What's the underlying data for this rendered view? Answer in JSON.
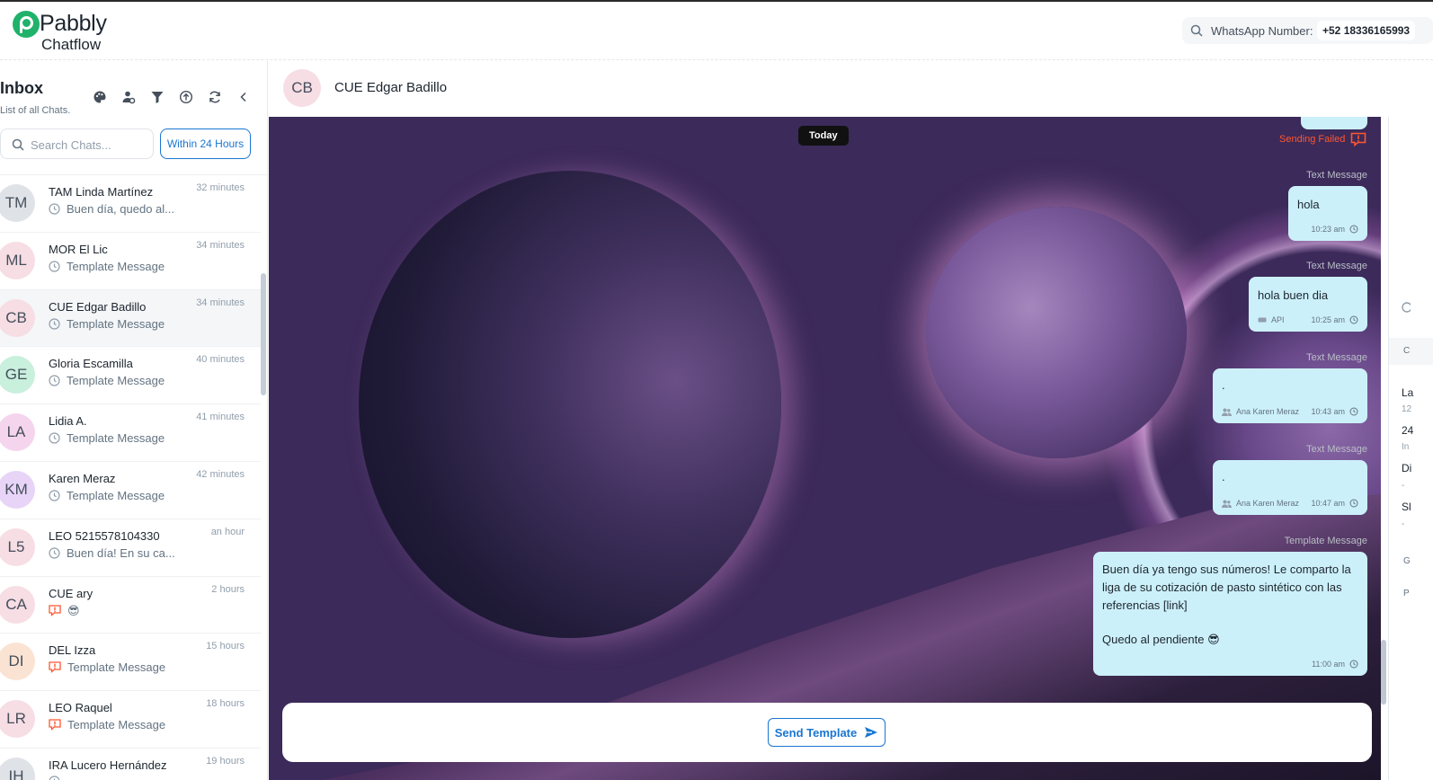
{
  "brand": {
    "name": "Pabbly",
    "sub": "Chatflow"
  },
  "header": {
    "wa_label": "WhatsApp Number:",
    "wa_number": "+52 18336165993"
  },
  "sidebar": {
    "title": "Inbox",
    "subtitle": "List of all Chats.",
    "search_placeholder": "Search Chats...",
    "filter_button": "Within 24 Hours",
    "tool_icons": [
      "palette-icon",
      "user-assign-icon",
      "filter-icon",
      "upload-icon",
      "refresh-icon",
      "chevron-left-icon"
    ],
    "chats": [
      {
        "initials": "TM",
        "name": "TAM Linda Martínez",
        "time": "32 minutes",
        "preview": "Buen día, quedo al...",
        "status": "clock",
        "avatar_color": "#dfe3e8"
      },
      {
        "initials": "ML",
        "name": "MOR El Lic",
        "time": "34 minutes",
        "preview": "Template Message",
        "status": "clock",
        "avatar_color": "#f7dde4"
      },
      {
        "initials": "CB",
        "name": "CUE Edgar Badillo",
        "time": "34 minutes",
        "preview": "Template Message",
        "status": "clock",
        "avatar_color": "#f7dde4"
      },
      {
        "initials": "GE",
        "name": "Gloria Escamilla",
        "time": "40 minutes",
        "preview": "Template Message",
        "status": "clock",
        "avatar_color": "#c9efdd"
      },
      {
        "initials": "LA",
        "name": "Lidia A.",
        "time": "41 minutes",
        "preview": "Template Message",
        "status": "clock",
        "avatar_color": "#f5d5ee"
      },
      {
        "initials": "KM",
        "name": "Karen Meraz",
        "time": "42 minutes",
        "preview": "Template Message",
        "status": "clock",
        "avatar_color": "#e8d4f7"
      },
      {
        "initials": "L5",
        "name": "LEO 5215578104330",
        "time": "an hour",
        "preview": "Buen día! En su ca...",
        "status": "clock",
        "avatar_color": "#f7dde4"
      },
      {
        "initials": "CA",
        "name": "CUE ary",
        "time": "2 hours",
        "preview": "😎",
        "status": "failed",
        "avatar_color": "#f7dde4"
      },
      {
        "initials": "DI",
        "name": "DEL Izza",
        "time": "15 hours",
        "preview": "Template Message",
        "status": "failed",
        "avatar_color": "#fbe3d3"
      },
      {
        "initials": "LR",
        "name": "LEO Raquel",
        "time": "18 hours",
        "preview": "Template Message",
        "status": "failed",
        "avatar_color": "#f7dde4"
      },
      {
        "initials": "IH",
        "name": "IRA Lucero Hernández",
        "time": "19 hours",
        "preview": "",
        "status": "clock",
        "avatar_color": "#dfe3e8"
      }
    ]
  },
  "chat": {
    "contact_initials": "CB",
    "contact_name": "CUE Edgar Badillo",
    "date_label": "Today",
    "sending_failed": "Sending Failed",
    "messages": [
      {
        "type": "Text Message",
        "text": "hola",
        "time": "10:23 am",
        "sender": ""
      },
      {
        "type": "Text Message",
        "text": "hola buen dia",
        "time": "10:25 am",
        "sender": "API"
      },
      {
        "type": "Text Message",
        "text": ".",
        "time": "10:43 am",
        "sender": "Ana Karen Meraz"
      },
      {
        "type": "Text Message",
        "text": ".",
        "time": "10:47 am",
        "sender": "Ana Karen Meraz"
      },
      {
        "type": "Template Message",
        "text": "Buen día ya tengo sus números! Le comparto la liga de su cotización de pasto sintético con las referencias [link]",
        "text2": "Quedo al pendiente 😎",
        "time": "11:00 am",
        "sender": ""
      }
    ],
    "send_template": "Send Template"
  },
  "right_panel": {
    "items": [
      "C",
      "La",
      "12",
      "24",
      "In",
      "Di",
      "-",
      "Sl",
      "-",
      "G",
      "P"
    ]
  }
}
